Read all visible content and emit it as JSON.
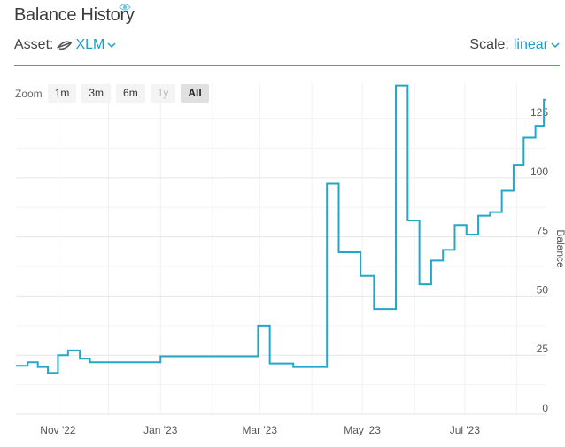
{
  "header": {
    "title": "Balance History",
    "asset_label": "Asset:",
    "asset_value": "XLM",
    "scale_label": "Scale:",
    "scale_value": "linear"
  },
  "zoom": {
    "label": "Zoom",
    "buttons": [
      {
        "label": "1m",
        "state": "normal"
      },
      {
        "label": "3m",
        "state": "normal"
      },
      {
        "label": "6m",
        "state": "normal"
      },
      {
        "label": "1y",
        "state": "disabled"
      },
      {
        "label": "All",
        "state": "active"
      }
    ]
  },
  "colors": {
    "series": "#22a7c9",
    "accent": "#1a9fc7"
  },
  "chart_data": {
    "type": "line",
    "step": true,
    "xlabel": "",
    "ylabel": "Balance",
    "x_ticks": [
      "Nov '22",
      "Jan '23",
      "Mar '23",
      "May '23",
      "Jul '23"
    ],
    "y_ticks": [
      0,
      25,
      50,
      75,
      100,
      125
    ],
    "ylim": [
      0,
      140
    ],
    "xlim": [
      "2022-10-07",
      "2023-08-18"
    ],
    "grid": true,
    "series": [
      {
        "x": [
          "2022-10-07",
          "2022-10-14",
          "2022-10-20",
          "2022-10-26",
          "2022-11-01",
          "2022-11-07",
          "2022-11-14",
          "2022-11-20",
          "2023-01-01",
          "2023-02-28",
          "2023-03-07",
          "2023-03-21",
          "2023-04-10",
          "2023-04-17",
          "2023-04-30",
          "2023-05-08",
          "2023-05-21",
          "2023-05-28",
          "2023-06-04",
          "2023-06-11",
          "2023-06-18",
          "2023-06-25",
          "2023-07-02",
          "2023-07-09",
          "2023-07-16",
          "2023-07-23",
          "2023-07-30",
          "2023-08-05",
          "2023-08-12",
          "2023-08-17"
        ],
        "y": [
          20.5,
          22,
          20,
          17.5,
          25,
          27,
          23.5,
          22,
          24.5,
          37.5,
          21.5,
          20,
          97.5,
          68.5,
          58.5,
          44.5,
          139,
          82,
          55,
          65,
          69.5,
          80,
          76,
          84,
          85.5,
          94.5,
          105.5,
          117,
          122,
          133
        ]
      }
    ]
  }
}
